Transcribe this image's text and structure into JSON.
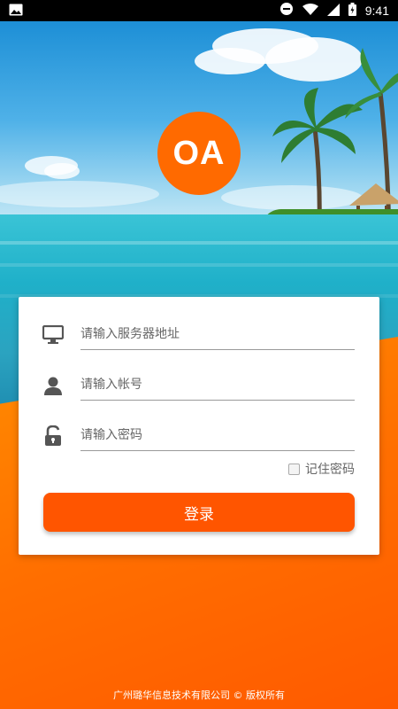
{
  "status_bar": {
    "time": "9:41",
    "icons": [
      "image-icon",
      "dnd-icon",
      "wifi-icon",
      "signal-icon",
      "battery-icon"
    ]
  },
  "logo": {
    "text": "OA"
  },
  "login": {
    "server_placeholder": "请输入服务器地址",
    "account_placeholder": "请输入帐号",
    "password_placeholder": "请输入密码",
    "remember_label": "记住密码",
    "remember_checked": false,
    "submit_label": "登录"
  },
  "footer": {
    "text": "广州璐华信息技术有限公司 © 版权所有"
  },
  "colors": {
    "brand_orange": "#ff6a00",
    "button": "#ff5500"
  }
}
